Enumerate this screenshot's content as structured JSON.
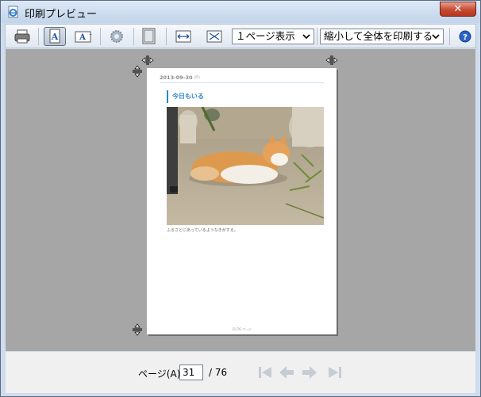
{
  "window": {
    "title": "印刷プレビュー",
    "close_label": "✕"
  },
  "toolbar": {
    "view_select": "１ページ表示",
    "scale_select": "縮小して全体を印刷する"
  },
  "preview": {
    "date": "2013-09-30",
    "date_sub": "(月)",
    "heading": "今日もいる",
    "caption": "ふるさとにあっているようなきがする。",
    "footer": "31/76 ページ"
  },
  "pager": {
    "label": "ページ(A)",
    "current": "31",
    "total": "/ 76"
  },
  "colors": {
    "accent": "#2b86c3",
    "preview_bg": "#a6a6a6"
  }
}
